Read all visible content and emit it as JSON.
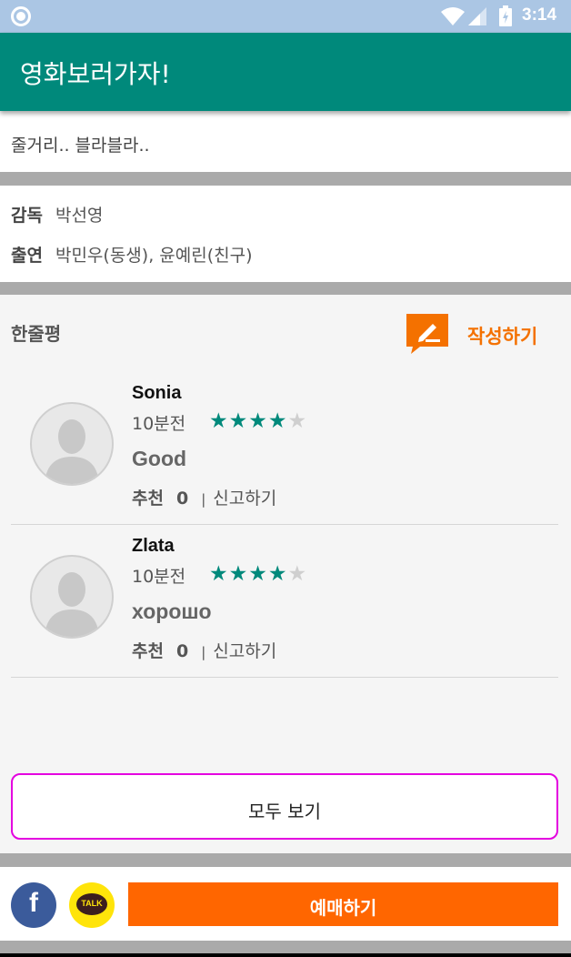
{
  "status_bar": {
    "time": "3:14",
    "color": "#abc6e4"
  },
  "app_bar": {
    "title": "영화보러가자!",
    "color": "#00897b"
  },
  "synopsis": {
    "text": "줄거리.. 블라블라.."
  },
  "credits": {
    "director_label": "감독",
    "director": "박선영",
    "cast_label": "출연",
    "cast": "박민우(동생), 윤예린(친구)"
  },
  "reviews": {
    "heading": "한줄평",
    "write_label": "작성하기",
    "items": [
      {
        "name": "Sonia",
        "time": "10분전",
        "rating": 4,
        "rating_max": 5,
        "body": "Good",
        "recommend_label": "추천",
        "recommend_count": "0",
        "separator": "|",
        "report_label": "신고하기"
      },
      {
        "name": "Zlata",
        "time": "10분전",
        "rating": 4,
        "rating_max": 5,
        "body": "хорошо",
        "recommend_label": "추천",
        "recommend_count": "0",
        "separator": "|",
        "report_label": "신고하기"
      }
    ],
    "view_all_label": "모두 보기"
  },
  "bottom_bar": {
    "facebook_glyph": "f",
    "kakao_text": "TALK",
    "book_label": "예매하기",
    "book_color": "#ff6600"
  },
  "icons": {
    "status": [
      "notification-circle-icon",
      "wifi-icon",
      "signal-icon",
      "battery-icon"
    ],
    "write": "write-review-icon",
    "avatar": "user-avatar-icon",
    "star": "star-icon"
  }
}
